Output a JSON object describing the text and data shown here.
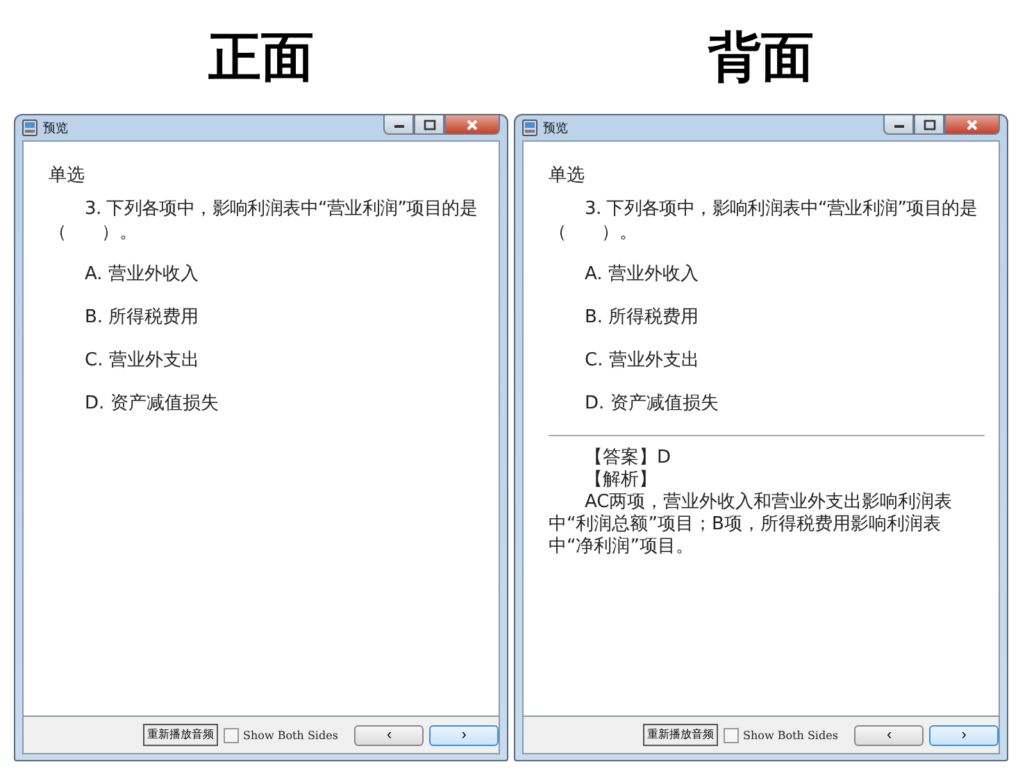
{
  "panels": [
    {
      "heading": "正面",
      "window": {
        "title": "预览"
      },
      "question_type": "单选",
      "question": "3. 下列各项中，影响利润表中“营业利润”项目的是（　　）。",
      "options": [
        "A.  营业外收入",
        "B.  所得税费用",
        "C.  营业外支出",
        "D.  资产减值损失"
      ],
      "footer": {
        "replay_button": "重新播放音频",
        "show_both_sides": {
          "label": "Show Both Sides",
          "checked": false
        },
        "prev_button": "‹",
        "next_button": "›"
      }
    },
    {
      "heading": "背面",
      "window": {
        "title": "预览"
      },
      "question_type": "单选",
      "question": "3. 下列各项中，影响利润表中“营业利润”项目的是（　　）。",
      "options": [
        "A.  营业外收入",
        "B.  所得税费用",
        "C.  营业外支出",
        "D.  资产减值损失"
      ],
      "answer": "【答案】D",
      "explanation_label": "【解析】",
      "explanation": "AC两项，营业外收入和营业外支出影响利润表中“利润总额”项目；B项，所得税费用影响利润表中“净利润”项目。",
      "footer": {
        "replay_button": "重新播放音频",
        "show_both_sides": {
          "label": "Show Both Sides",
          "checked": false
        },
        "prev_button": "‹",
        "next_button": "›"
      }
    }
  ]
}
